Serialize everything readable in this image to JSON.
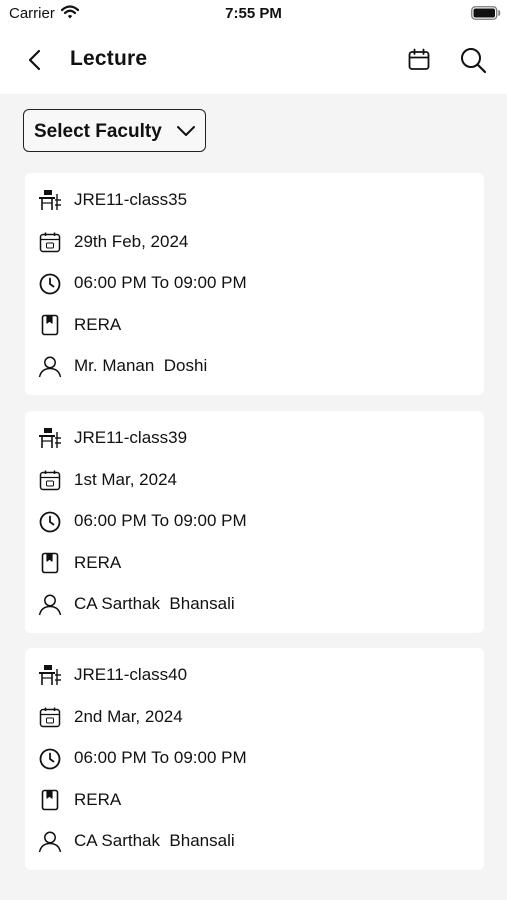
{
  "status_bar": {
    "carrier": "Carrier",
    "time": "7:55 PM"
  },
  "header": {
    "title": "Lecture"
  },
  "filter": {
    "label": "Select Faculty"
  },
  "lectures": [
    {
      "class": "JRE11-class35",
      "date": "29th Feb, 2024",
      "time": "06:00 PM To 09:00 PM",
      "subject": "RERA",
      "faculty": "Mr. Manan  Doshi"
    },
    {
      "class": "JRE11-class39",
      "date": "1st Mar, 2024",
      "time": "06:00 PM To 09:00 PM",
      "subject": "RERA",
      "faculty": "CA Sarthak  Bhansali"
    },
    {
      "class": "JRE11-class40",
      "date": "2nd Mar, 2024",
      "time": "06:00 PM To 09:00 PM",
      "subject": "RERA",
      "faculty": "CA Sarthak  Bhansali"
    }
  ],
  "icons": {
    "class": "classroom-icon",
    "date": "calendar-icon",
    "time": "clock-icon",
    "subject": "book-icon",
    "faculty": "person-icon"
  }
}
